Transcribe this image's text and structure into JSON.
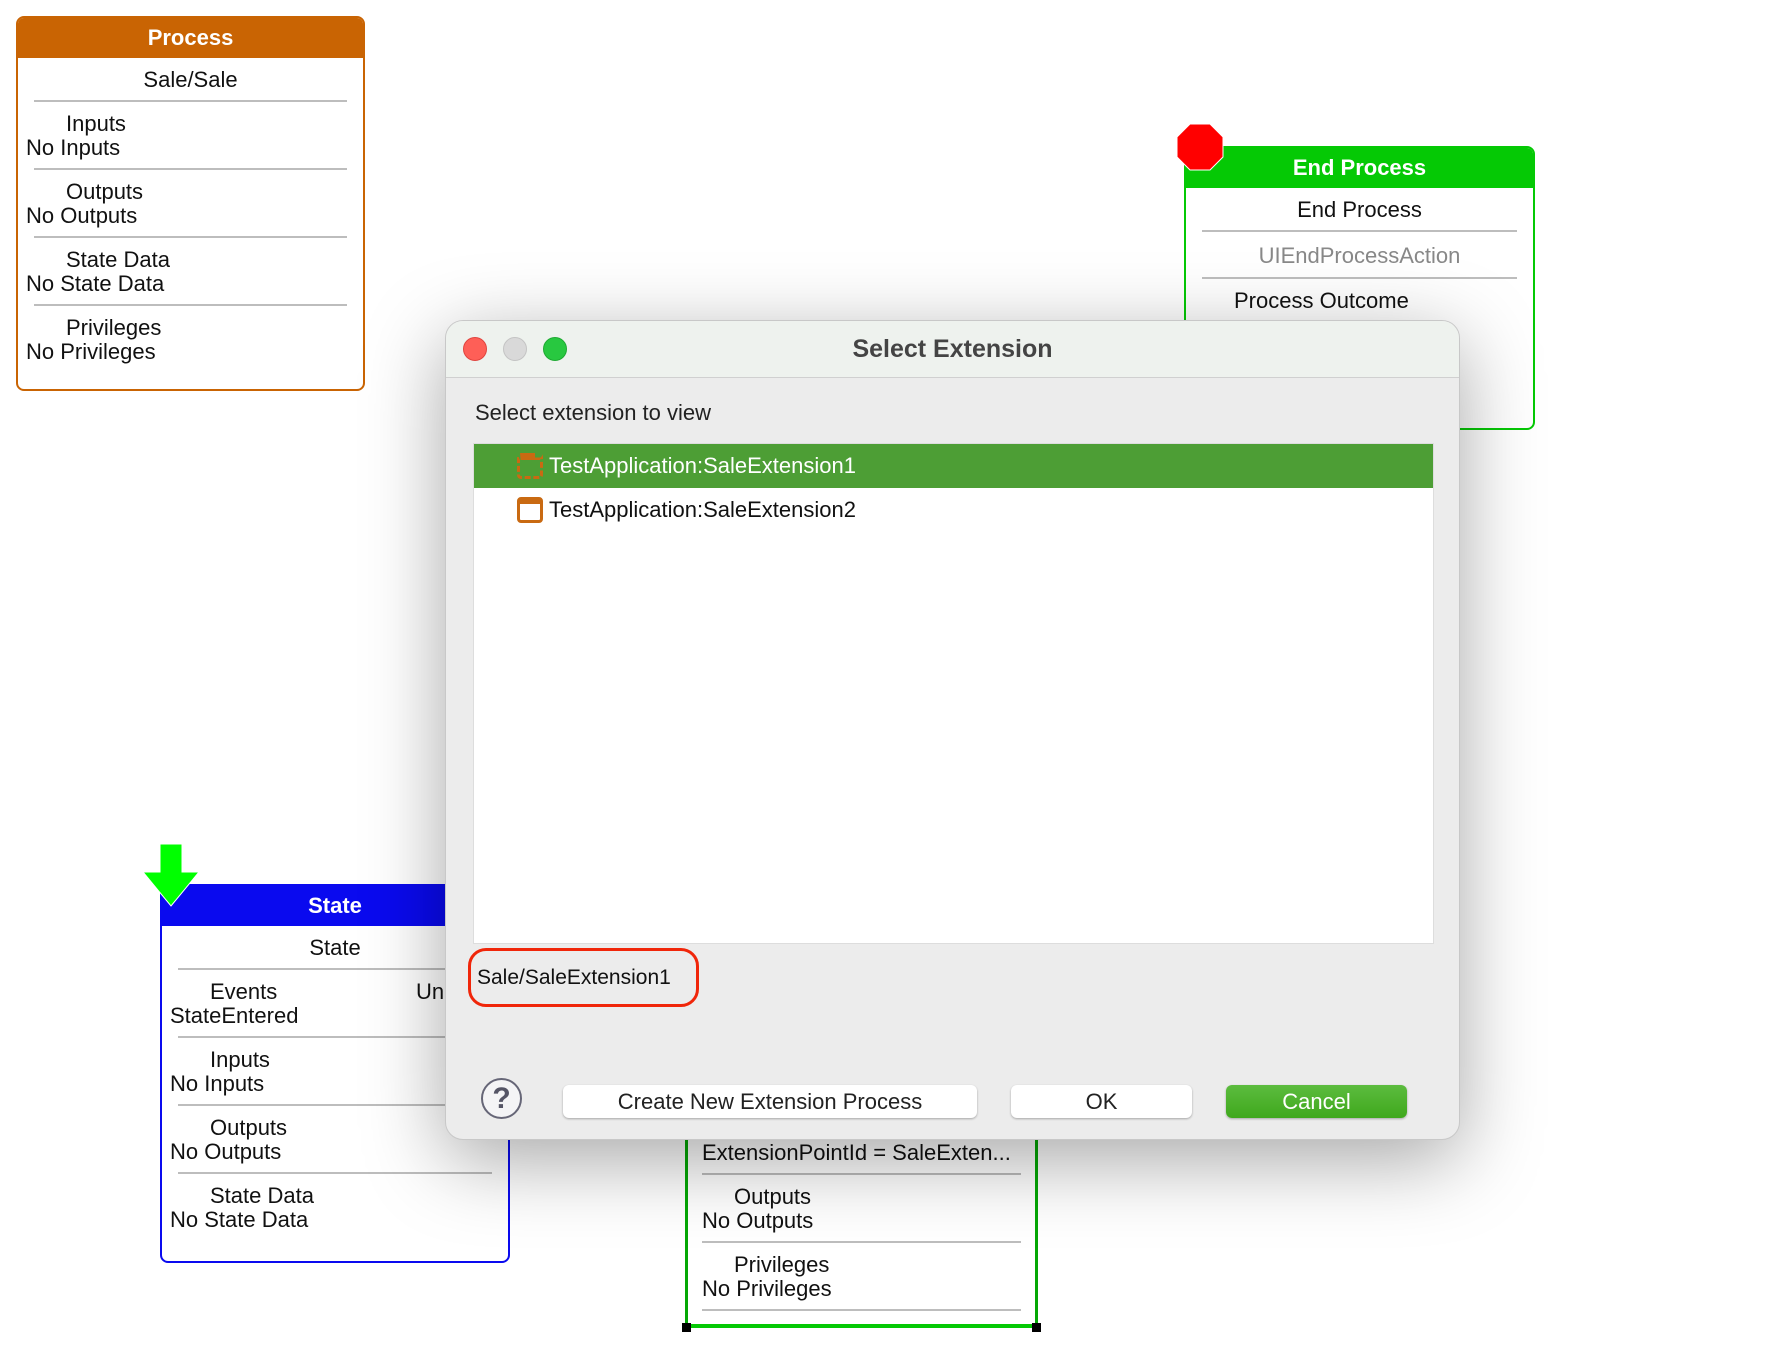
{
  "process_node": {
    "header": "Process",
    "title": "Sale/Sale",
    "sections": [
      {
        "label": "Inputs",
        "value": "No Inputs"
      },
      {
        "label": "Outputs",
        "value": "No Outputs"
      },
      {
        "label": "State Data",
        "value": "No State Data"
      },
      {
        "label": "Privileges",
        "value": "No Privileges"
      }
    ],
    "color": "#c96403"
  },
  "end_node": {
    "header": "End Process",
    "title": "End Process",
    "action": "UIEndProcessAction",
    "outcome_label": "Process Outcome",
    "color": "#05c905",
    "icon": "stop-octagon-icon"
  },
  "state_node": {
    "header": "State",
    "title": "State",
    "events_label": "Events",
    "events_value": "StateEntered",
    "events_right": "Unu",
    "sections": [
      {
        "label": "Inputs",
        "value": "No Inputs"
      },
      {
        "label": "Outputs",
        "value": "No Outputs"
      },
      {
        "label": "State Data",
        "value": "No State Data"
      }
    ],
    "color": "#0a0aef",
    "icon": "start-arrow-icon"
  },
  "extension_node": {
    "line": "ExtensionPointId = SaleExten...",
    "sections": [
      {
        "label": "Outputs",
        "value": "No Outputs"
      },
      {
        "label": "Privileges",
        "value": "No Privileges"
      }
    ]
  },
  "dialog": {
    "title": "Select Extension",
    "prompt": "Select extension to view",
    "items": [
      {
        "label": "TestApplication:SaleExtension1",
        "selected": true
      },
      {
        "label": "TestApplication:SaleExtension2",
        "selected": false
      }
    ],
    "selected_path": "Sale/SaleExtension1",
    "help": "?",
    "create_label": "Create New Extension Process",
    "ok_label": "OK",
    "cancel_label": "Cancel",
    "accent": "#4d9e35"
  }
}
